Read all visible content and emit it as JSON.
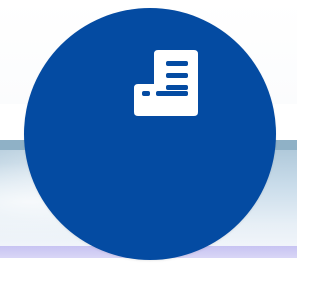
{
  "colors": {
    "accent": "#044ba2",
    "icon": "#ffffff",
    "banner_top": "#8fb1c6",
    "strip": "#c7c3f2"
  },
  "floating_button": {
    "icon": "receipt-document-icon"
  }
}
